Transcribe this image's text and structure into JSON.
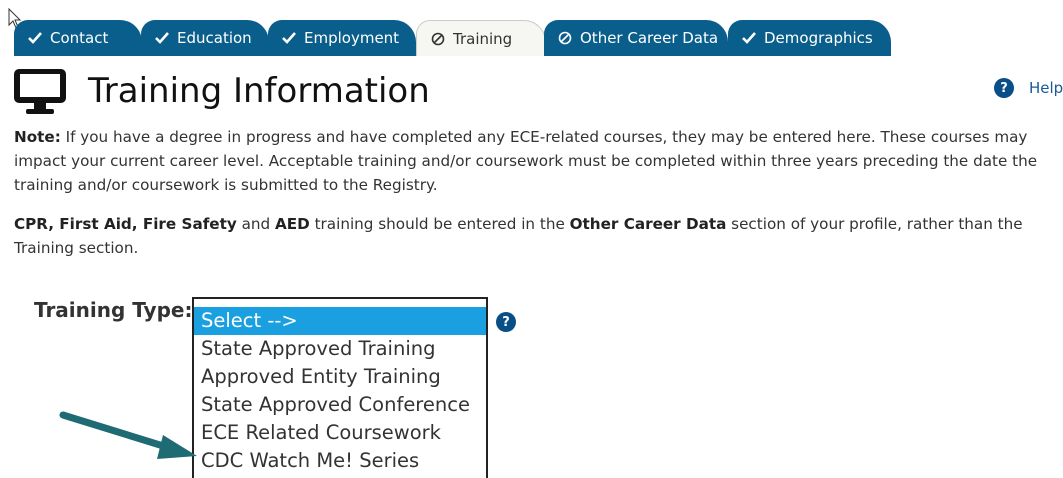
{
  "tabs": [
    {
      "label": "Contact",
      "status": "complete"
    },
    {
      "label": "Education",
      "status": "complete"
    },
    {
      "label": "Employment",
      "status": "complete"
    },
    {
      "label": "Training",
      "status": "incomplete",
      "active": true
    },
    {
      "label": "Other Career Data",
      "status": "incomplete"
    },
    {
      "label": "Demographics",
      "status": "complete"
    }
  ],
  "page": {
    "title": "Training Information",
    "help_label": "Help",
    "help_icon": "?"
  },
  "note": {
    "label": "Note:",
    "text": " If you have a degree in progress and have completed any ECE-related courses, they may be entered here. These courses may impact your current career level. Acceptable training and/or coursework must be completed within three years preceding the date the training and/or coursework is submitted to the Registry."
  },
  "cpr": {
    "part1": "CPR, First Aid, Fire Safety",
    "part2": " and ",
    "part3": "AED",
    "part4": " training should be entered in the ",
    "part5": "Other Career Data",
    "part6": " section of your profile, rather than the Training section."
  },
  "training_type": {
    "label": "Training Type:",
    "help_icon": "?",
    "options": [
      "Select -->",
      "State Approved Training",
      "Approved Entity Training",
      "State Approved Conference",
      "ECE Related Coursework",
      "CDC Watch Me! Series"
    ],
    "selected_index": 0
  },
  "colors": {
    "tab_bg": "#0a5e8c",
    "selected_option": "#1aa0e0",
    "arrow": "#1f6b73"
  }
}
